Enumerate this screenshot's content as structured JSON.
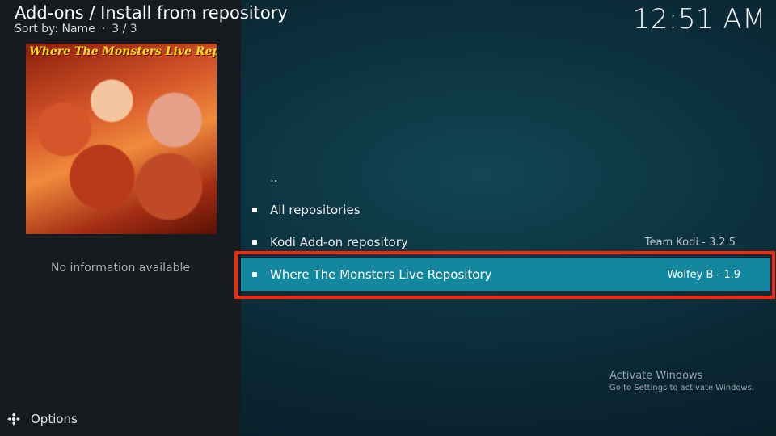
{
  "header": {
    "title": "Add-ons / Install from repository",
    "sort_label": "Sort by: Name",
    "separator": "·",
    "position": "3 / 3",
    "clock": "12:51 AM"
  },
  "sidebar": {
    "thumbnail_title": "Where The Monsters Live Repo",
    "info_text": "No information available",
    "options_label": "Options",
    "options_icon": "options-gear-icon"
  },
  "list": {
    "items": [
      {
        "label": "..",
        "meta": "",
        "bullet": false,
        "selected": false
      },
      {
        "label": "All repositories",
        "meta": "",
        "bullet": true,
        "selected": false
      },
      {
        "label": "Kodi Add-on repository",
        "meta": "Team Kodi - 3.2.5",
        "bullet": true,
        "selected": false
      },
      {
        "label": "Where The Monsters Live Repository",
        "meta": "Wolfey B - 1.9",
        "bullet": true,
        "selected": true
      }
    ]
  },
  "watermark": {
    "title": "Activate Windows",
    "subtitle": "Go to Settings to activate Windows."
  },
  "colors": {
    "selection": "#12879e",
    "highlight_border": "#ee2a10",
    "sidebar_bg": "#161b1f"
  }
}
